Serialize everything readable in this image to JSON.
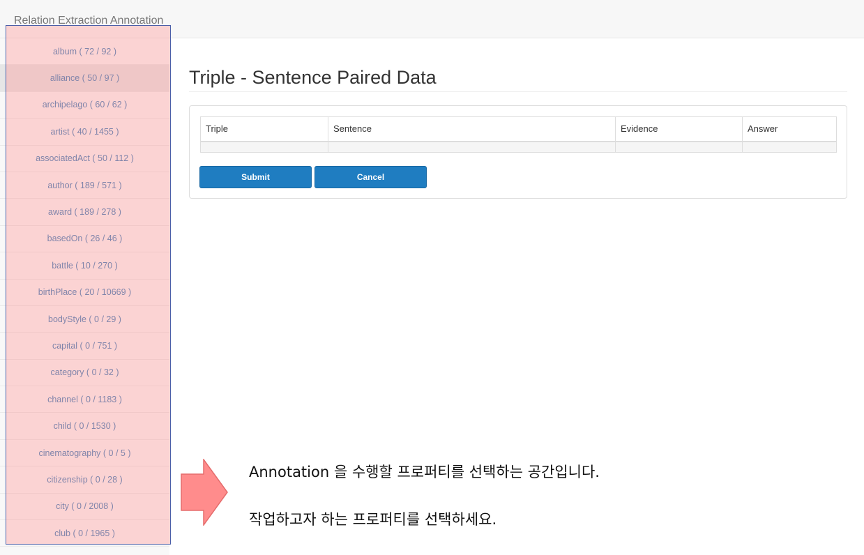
{
  "app": {
    "title": "Relation Extraction Annotation"
  },
  "sidebar": {
    "items": [
      {
        "label": "album ( 72 / 92 )"
      },
      {
        "label": "alliance ( 50 / 97 )",
        "active": true
      },
      {
        "label": "archipelago ( 60 / 62 )"
      },
      {
        "label": "artist ( 40 / 1455 )"
      },
      {
        "label": "associatedAct ( 50 / 112 )"
      },
      {
        "label": "author ( 189 / 571 )"
      },
      {
        "label": "award ( 189 / 278 )"
      },
      {
        "label": "basedOn ( 26 / 46 )"
      },
      {
        "label": "battle ( 10 / 270 )"
      },
      {
        "label": "birthPlace ( 20 / 10669 )"
      },
      {
        "label": "bodyStyle ( 0 / 29 )"
      },
      {
        "label": "capital ( 0 / 751 )"
      },
      {
        "label": "category ( 0 / 32 )"
      },
      {
        "label": "channel ( 0 / 1183 )"
      },
      {
        "label": "child ( 0 / 1530 )"
      },
      {
        "label": "cinematography ( 0 / 5 )"
      },
      {
        "label": "citizenship ( 0 / 28 )"
      },
      {
        "label": "city ( 0 / 2008 )"
      },
      {
        "label": "club ( 0 / 1965 )"
      }
    ]
  },
  "main": {
    "title": "Triple - Sentence Paired Data",
    "table": {
      "headers": [
        "Triple",
        "Sentence",
        "Evidence",
        "Answer"
      ]
    },
    "buttons": {
      "submit": "Submit",
      "cancel": "Cancel"
    }
  },
  "annotation": {
    "line1": "Annotation 을 수행할 프로퍼티를 선택하는 공간입니다.",
    "line2": "작업하고자 하는 프로퍼티를 선택하세요.",
    "highlight_color": "#ff9696",
    "arrow_color": "#ff8c8c"
  }
}
